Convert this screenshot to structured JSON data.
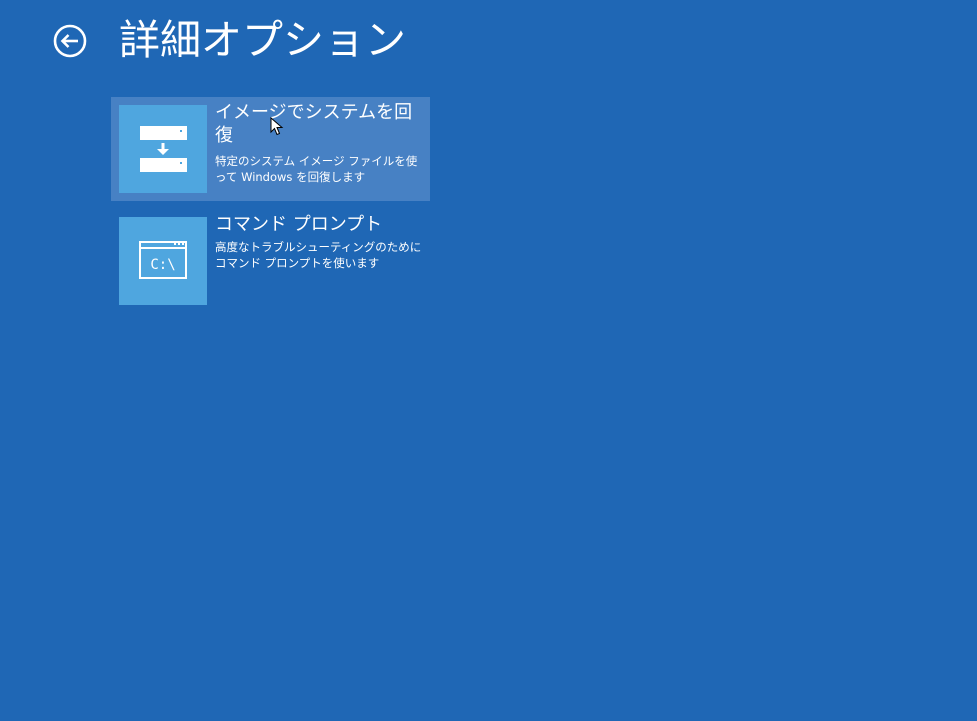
{
  "header": {
    "title": "詳細オプション",
    "back_icon": "back-arrow-circle-icon"
  },
  "options": [
    {
      "title": "イメージでシステムを回復",
      "description": "特定のシステム イメージ ファイルを使って Windows を回復します",
      "icon": "system-image-recovery-icon",
      "state": "hovered"
    },
    {
      "title": "コマンド プロンプト",
      "description": "高度なトラブルシューティングのためにコマンド プロンプトを使います",
      "icon": "command-prompt-icon",
      "icon_text": "C:\\"
    }
  ],
  "colors": {
    "background": "#1f67b5",
    "tile_hover": "#4781c4",
    "icon_tile": "#4fa6df",
    "text": "#ffffff"
  }
}
